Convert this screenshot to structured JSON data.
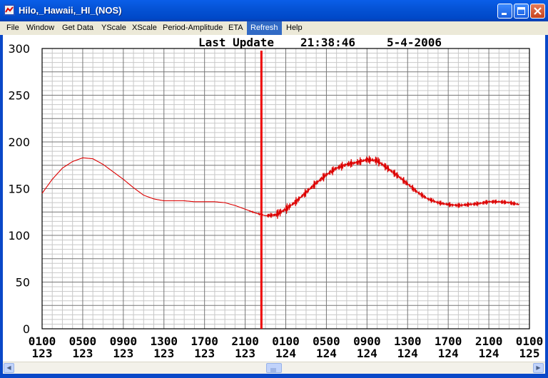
{
  "window": {
    "title": "Hilo,_Hawaii,_HI_(NOS)"
  },
  "menu": {
    "items": [
      "File",
      "Window",
      "Get Data",
      "YScale",
      "XScale",
      "Period-Amplitude",
      "ETA",
      "Refresh",
      "Help"
    ],
    "active": "Refresh"
  },
  "chart_header": {
    "last_update_label": "Last Update",
    "time": "21:38:46",
    "date": "5-4-2006"
  },
  "colors": {
    "series": "#dd0000",
    "marker": "#ee0000",
    "grid_major": "#777777",
    "grid_minor": "#c8c8c8"
  },
  "chart_data": {
    "type": "line",
    "title": "",
    "xlabel": "",
    "ylabel": "",
    "ylim": [
      0,
      300
    ],
    "y_ticks": [
      "0",
      "50",
      "100",
      "150",
      "200",
      "250",
      "300"
    ],
    "x_ticks": [
      {
        "time": "0100",
        "day": "123"
      },
      {
        "time": "0500",
        "day": "123"
      },
      {
        "time": "0900",
        "day": "123"
      },
      {
        "time": "1300",
        "day": "123"
      },
      {
        "time": "1700",
        "day": "123"
      },
      {
        "time": "2100",
        "day": "123"
      },
      {
        "time": "0100",
        "day": "124"
      },
      {
        "time": "0500",
        "day": "124"
      },
      {
        "time": "0900",
        "day": "124"
      },
      {
        "time": "1300",
        "day": "124"
      },
      {
        "time": "1700",
        "day": "124"
      },
      {
        "time": "2100",
        "day": "124"
      },
      {
        "time": "0100",
        "day": "125"
      }
    ],
    "x_range_hours": [
      0,
      48
    ],
    "current_time_marker_hours": 21.6,
    "grid": true,
    "series": [
      {
        "x_hours": [
          0,
          1,
          2,
          3,
          4,
          5,
          6,
          7,
          8,
          9,
          10,
          11,
          12,
          13,
          14,
          15,
          16,
          17,
          18,
          19,
          20,
          21,
          22,
          23,
          24,
          25,
          26,
          27,
          28,
          29,
          30,
          31,
          32,
          33,
          34,
          35,
          36,
          37,
          38,
          39,
          40,
          41,
          42,
          43,
          44,
          45,
          46,
          47
        ],
        "values": [
          145,
          160,
          172,
          179,
          183,
          182,
          176,
          168,
          160,
          151,
          143,
          139,
          137,
          137,
          137,
          136,
          136,
          136,
          135,
          132,
          128,
          124,
          121,
          122,
          128,
          136,
          146,
          156,
          165,
          172,
          176,
          178,
          181,
          180,
          172,
          164,
          155,
          146,
          139,
          135,
          133,
          132,
          133,
          134,
          136,
          136,
          135,
          133
        ],
        "noise_amplitude": [
          0,
          0,
          0,
          0,
          0,
          0,
          0,
          0,
          0,
          0,
          0,
          0,
          0,
          0,
          0,
          0,
          0,
          0,
          0,
          0,
          0,
          1,
          1,
          6,
          6,
          5,
          5,
          5,
          5,
          5,
          5,
          5,
          5,
          6,
          5,
          5,
          4,
          4,
          3,
          3,
          3,
          3,
          3,
          3,
          3,
          3,
          3,
          3
        ]
      }
    ]
  }
}
